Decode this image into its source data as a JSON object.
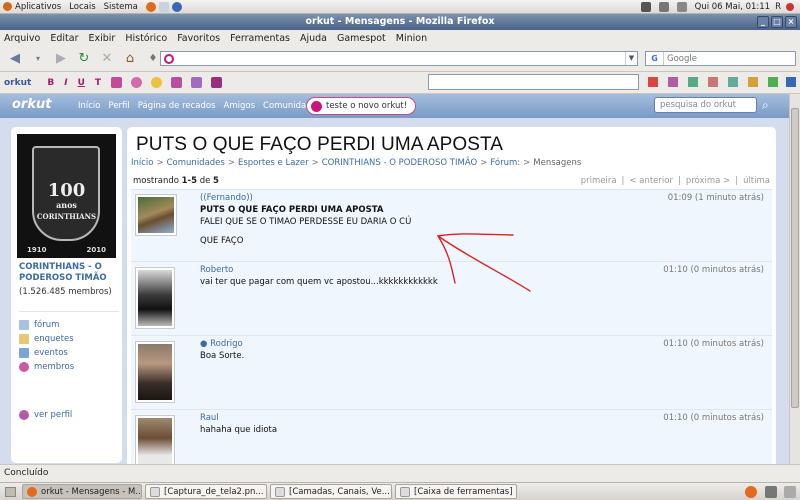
{
  "gnome_panel": {
    "menus": [
      "Aplicativos",
      "Locais",
      "Sistema"
    ],
    "clock": "Qui 06 Mai, 01:11",
    "user": "R"
  },
  "window": {
    "title": "orkut - Mensagens - Mozilla Firefox"
  },
  "menubar": [
    "Arquivo",
    "Editar",
    "Exibir",
    "Histórico",
    "Favoritos",
    "Ferramentas",
    "Ajuda",
    "Gamespot",
    "Minion"
  ],
  "navbar": {
    "url": "",
    "search_placeholder": "Google",
    "search_engine_letter": "G"
  },
  "orkut_toolbar": {
    "brand": "orkut",
    "bold": "B",
    "italic": "I",
    "underline": "U",
    "textsize": "T"
  },
  "orkut_header": {
    "logo": "orkut",
    "links": [
      "Início",
      "Perfil",
      "Página de recados",
      "Amigos",
      "Comunidades"
    ],
    "try_new": "teste o novo orkut!",
    "search_placeholder": "pesquisa do orkut"
  },
  "community": {
    "badge_text": "100",
    "badge_sub": "anos",
    "badge_name": "CORINTHIANS",
    "year_start": "1910",
    "year_end": "2010",
    "name": "CORINTHIANS - O PODEROSO TIMÃO",
    "members": "(1.526.485 membros)",
    "menu": [
      "fórum",
      "enquetes",
      "eventos",
      "membros"
    ],
    "profile_link": "ver perfil"
  },
  "topic": {
    "title": "PUTS O QUE FAÇO PERDI UMA APOSTA",
    "breadcrumb": [
      "Início",
      "Comunidades",
      "Esportes e Lazer",
      "CORINTHIANS - O PODEROSO TIMÃO",
      "Fórum:",
      "Mensagens"
    ],
    "showing_prefix": "mostrando ",
    "showing_range": "1-5",
    "showing_mid": " de ",
    "showing_total": "5",
    "pager": [
      "primeira",
      "|",
      "< anterior",
      "|",
      "próxima >",
      "|",
      "última"
    ]
  },
  "posts": [
    {
      "author": "((Fernando))",
      "time": "01:09 (1 minuto atrás)",
      "subject": "PUTS O QUE FAÇO PERDI UMA APOSTA",
      "line1": "FALEI QUE SE O TIMAO PERDESSE EU DARIA O CÚ",
      "line2": "QUE FAÇO"
    },
    {
      "author": "Roberto",
      "time": "01:10 (0 minutos atrás)",
      "text": "vai ter que pagar com quem vc apostou...kkkkkkkkkkkk"
    },
    {
      "author": "● Rodrigo",
      "time": "01:10 (0 minutos atrás)",
      "text": "Boa Sorte."
    },
    {
      "author": "Raul",
      "time": "01:10 (0 minutos atrás)",
      "text": "hahaha que idiota"
    }
  ],
  "statusbar": {
    "text": "Concluído"
  },
  "taskbar": [
    "orkut - Mensagens - M...",
    "[Captura_de_tela2.pn...",
    "[Camadas, Canais, Ve...",
    "[Caixa de ferramentas]"
  ],
  "colors": {
    "link": "#3b6aa5",
    "header_bg": "#7a9bc6",
    "post_bg": "#f0f6fd",
    "annotation": "#e02020"
  }
}
